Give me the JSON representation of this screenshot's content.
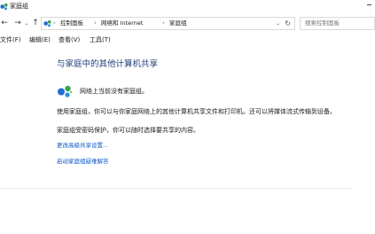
{
  "window": {
    "title": "家庭组"
  },
  "address": {
    "segments": [
      "控制面板",
      "网络和 Internet",
      "家庭组"
    ],
    "search_placeholder": "搜索控制面板"
  },
  "menu": [
    "文件(F)",
    "编辑(E)",
    "查看(V)",
    "工具(T)"
  ],
  "main": {
    "heading": "与家庭中的其他计算机共享",
    "status": "网络上当前没有家庭组。",
    "description": "使用家庭组，你可以与你家庭网络上的其他计算机共享文件和打印机。还可以将媒体流式传输到设备。",
    "protection": "家庭组受密码保护，你可以随时选择要共享的内容。",
    "links": [
      "更改高级共享设置...",
      "启动家庭组疑难解答"
    ]
  },
  "colors": {
    "heading": "#1e3f7a",
    "link": "#0b57c6",
    "homegroup_blue": "#1f6fd6",
    "homegroup_green": "#3aa34a"
  }
}
